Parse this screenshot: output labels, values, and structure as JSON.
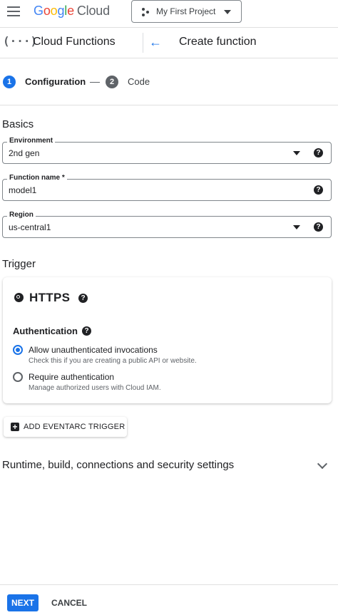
{
  "header": {
    "app_name": "Cloud",
    "project_selector": "My First Project"
  },
  "subheader": {
    "product_title": "Cloud Functions",
    "page_title": "Create function"
  },
  "stepper": {
    "steps": [
      {
        "number": "1",
        "label": "Configuration",
        "active": true
      },
      {
        "number": "2",
        "label": "Code",
        "active": false
      }
    ]
  },
  "basics": {
    "title": "Basics",
    "environment": {
      "label": "Environment",
      "value": "2nd gen"
    },
    "function_name": {
      "label": "Function name *",
      "value": "model1"
    },
    "region": {
      "label": "Region",
      "value": "us-central1"
    }
  },
  "trigger": {
    "title": "Trigger",
    "type": "HTTPS",
    "authentication": {
      "title": "Authentication",
      "options": [
        {
          "label": "Allow unauthenticated invocations",
          "description": "Check this if you are creating a public API or website.",
          "selected": true
        },
        {
          "label": "Require authentication",
          "description": "Manage authorized users with Cloud IAM.",
          "selected": false
        }
      ]
    },
    "add_eventarc_label": "ADD EVENTARC TRIGGER"
  },
  "runtime_section": {
    "title": "Runtime, build, connections and security settings"
  },
  "footer": {
    "next_label": "NEXT",
    "cancel_label": "CANCEL"
  },
  "colors": {
    "accent": "#1a73e8",
    "text": "#202124",
    "muted": "#5f6368"
  }
}
